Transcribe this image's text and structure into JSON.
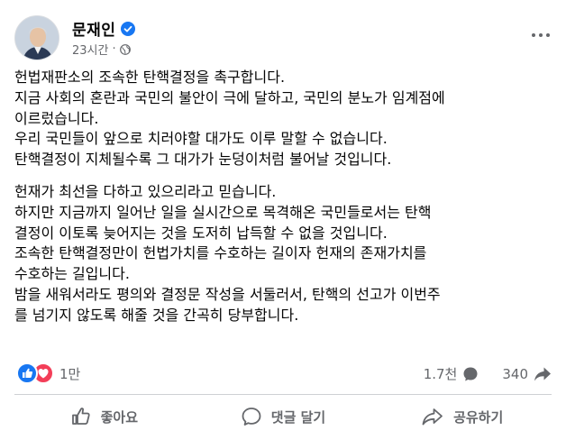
{
  "author": {
    "name": "문재인",
    "verified": true
  },
  "meta": {
    "time": "23시간",
    "separator": "·",
    "audience_icon": "globe-icon"
  },
  "post": {
    "paragraphs": [
      {
        "lines": [
          "헌법재판소의 조속한 탄핵결정을 촉구합니다.",
          "지금 사회의 혼란과 국민의 불안이 극에 달하고, 국민의 분노가 임계점에",
          "이르렀습니다.",
          "우리 국민들이 앞으로 치러야할 대가도 이루 말할 수 없습니다.",
          "탄핵결정이 지체될수록 그 대가가 눈덩이처럼 불어날 것입니다."
        ]
      },
      {
        "lines": [
          "헌재가 최선을 다하고 있으리라고 믿습니다.",
          "하지만 지금까지 일어난 일을 실시간으로 목격해온 국민들로서는 탄핵",
          "결정이 이토록 늦어지는 것을 도저히 납득할 수 없을 것입니다.",
          "조속한 탄핵결정만이 헌법가치를 수호하는 길이자 헌재의 존재가치를",
          "수호하는 길입니다.",
          "밤을 새워서라도 평의와 결정문 작성을 서둘러서, 탄핵의 선고가 이번주",
          "를 넘기지 않도록 해줄 것을 간곡히 당부합니다."
        ]
      }
    ]
  },
  "reactions": {
    "count": "1만",
    "types": [
      "like",
      "love"
    ]
  },
  "stats": {
    "comments": "1.7천",
    "shares": "340"
  },
  "actions": {
    "like": "좋아요",
    "comment": "댓글 달기",
    "share": "공유하기"
  },
  "colors": {
    "primary": "#1877f2",
    "love": "#f33e58",
    "secondary_text": "#65676b",
    "divider": "#ced0d4"
  }
}
